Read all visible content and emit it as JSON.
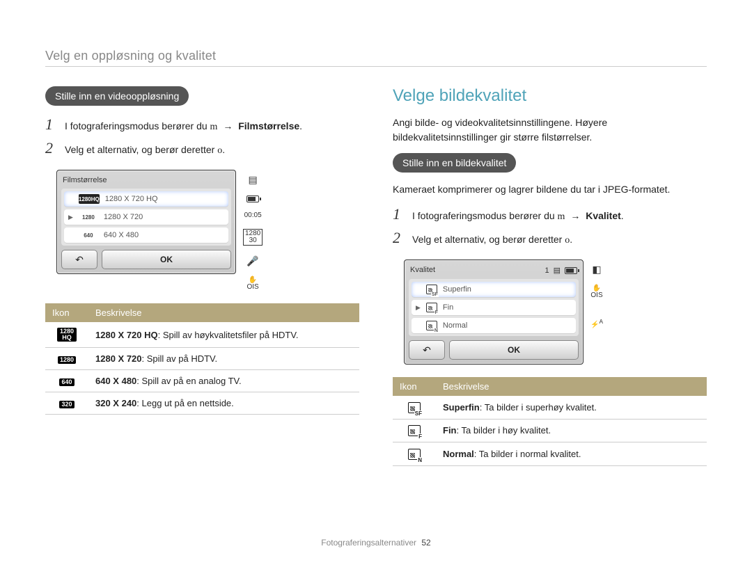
{
  "breadcrumb": "Velg en oppløsning og kvalitet",
  "left": {
    "pill": "Stille inn en videooppløsning",
    "steps": [
      {
        "num": "1",
        "pre": "I fotograferingsmodus berører du ",
        "mid": "m",
        "arrow": "→",
        "bold": "Filmstørrelse",
        "post": "."
      },
      {
        "num": "2",
        "pre": "Velg et alternativ, og berør deretter ",
        "mid": "o",
        "post": "."
      }
    ],
    "screen": {
      "title": "Filmstørrelse",
      "items": [
        {
          "iconTop": "1280",
          "iconBottom": "HQ",
          "label": "1280 X 720 HQ",
          "selected": true,
          "tri": false
        },
        {
          "icon": "1280",
          "label": "1280 X 720",
          "selected": false,
          "tri": true
        },
        {
          "icon": "640",
          "label": "640 X 480",
          "selected": false,
          "tri": false
        }
      ],
      "timer": "00:05",
      "ok": "OK"
    },
    "table": {
      "headers": [
        "Ikon",
        "Beskrivelse"
      ],
      "rows": [
        {
          "iconTop": "1280",
          "iconBottom": "HQ",
          "bold": "1280 X 720 HQ",
          "desc": ": Spill av høykvalitetsfiler på HDTV."
        },
        {
          "icon": "1280",
          "bold": "1280 X 720",
          "desc": ": Spill av på HDTV."
        },
        {
          "icon": "640",
          "bold": "640 X 480",
          "desc": ": Spill av på en analog TV."
        },
        {
          "icon": "320",
          "bold": "320 X 240",
          "desc": ": Legg ut på en nettside."
        }
      ]
    }
  },
  "right": {
    "title": "Velge bildekvalitet",
    "intro": "Angi bilde- og videokvalitetsinnstillingene. Høyere bildekvalitetsinnstillinger gir større filstørrelser.",
    "pill": "Stille inn en bildekvalitet",
    "note": "Kameraet komprimerer og lagrer bildene du tar i JPEG-formatet.",
    "steps": [
      {
        "num": "1",
        "pre": "I fotograferingsmodus berører du ",
        "mid": "m",
        "arrow": "→",
        "bold": "Kvalitet",
        "post": "."
      },
      {
        "num": "2",
        "pre": "Velg et alternativ, og berør deretter ",
        "mid": "o",
        "post": "."
      }
    ],
    "screen": {
      "title": "Kvalitet",
      "counter": "1",
      "items": [
        {
          "sub": "SF",
          "label": "Superfin",
          "selected": true,
          "tri": false
        },
        {
          "sub": "F",
          "label": "Fin",
          "selected": false,
          "tri": true
        },
        {
          "sub": "N",
          "label": "Normal",
          "selected": false,
          "tri": false
        }
      ],
      "ok": "OK"
    },
    "table": {
      "headers": [
        "Ikon",
        "Beskrivelse"
      ],
      "rows": [
        {
          "sub": "SF",
          "bold": "Superfin",
          "desc": ": Ta bilder i superhøy kvalitet."
        },
        {
          "sub": "F",
          "bold": "Fin",
          "desc": ": Ta bilder i høy kvalitet."
        },
        {
          "sub": "N",
          "bold": "Normal",
          "desc": ": Ta bilder i normal kvalitet."
        }
      ]
    }
  },
  "footer": {
    "section": "Fotograferingsalternativer",
    "page": "52"
  }
}
